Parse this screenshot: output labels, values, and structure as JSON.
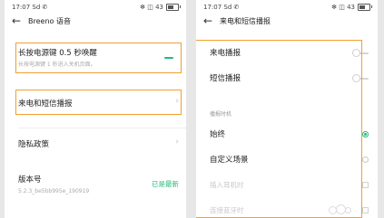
{
  "left": {
    "status": {
      "time": "17:07",
      "indicators": "Sd ✆",
      "right": "✻ ◫ 43"
    },
    "header": {
      "title": "Breeno 语音"
    },
    "items": [
      {
        "label": "长按电源键 0.5 秒唤醒",
        "sub": "长按电源键 1 秒进入关机页面。",
        "control": "toggle-on"
      },
      {
        "label": "来电和短信播报",
        "control": "chevron"
      },
      {
        "label": "隐私政策",
        "control": "chevron"
      },
      {
        "label": "版本号",
        "sub": "5.2.3_be5bb995e_190919",
        "value": "已是最新"
      }
    ]
  },
  "right": {
    "status": {
      "time": "17:07",
      "indicators": "Sd ✆",
      "right": "✻ ◫ 43"
    },
    "header": {
      "title": "来电和短信播报"
    },
    "toggles": [
      {
        "label": "来电播报",
        "state": "off"
      },
      {
        "label": "短信播报",
        "state": "off"
      }
    ],
    "section_title": "播报时机",
    "radios": [
      {
        "label": "始终",
        "selected": true
      },
      {
        "label": "自定义场景",
        "selected": false
      }
    ],
    "checkboxes": [
      {
        "label": "插入耳机时",
        "checked": false,
        "disabled": true
      },
      {
        "label": "连接蓝牙时",
        "checked": false,
        "disabled": true
      }
    ]
  },
  "colors": {
    "accent": "#27b87a",
    "highlight": "#f0a030"
  }
}
